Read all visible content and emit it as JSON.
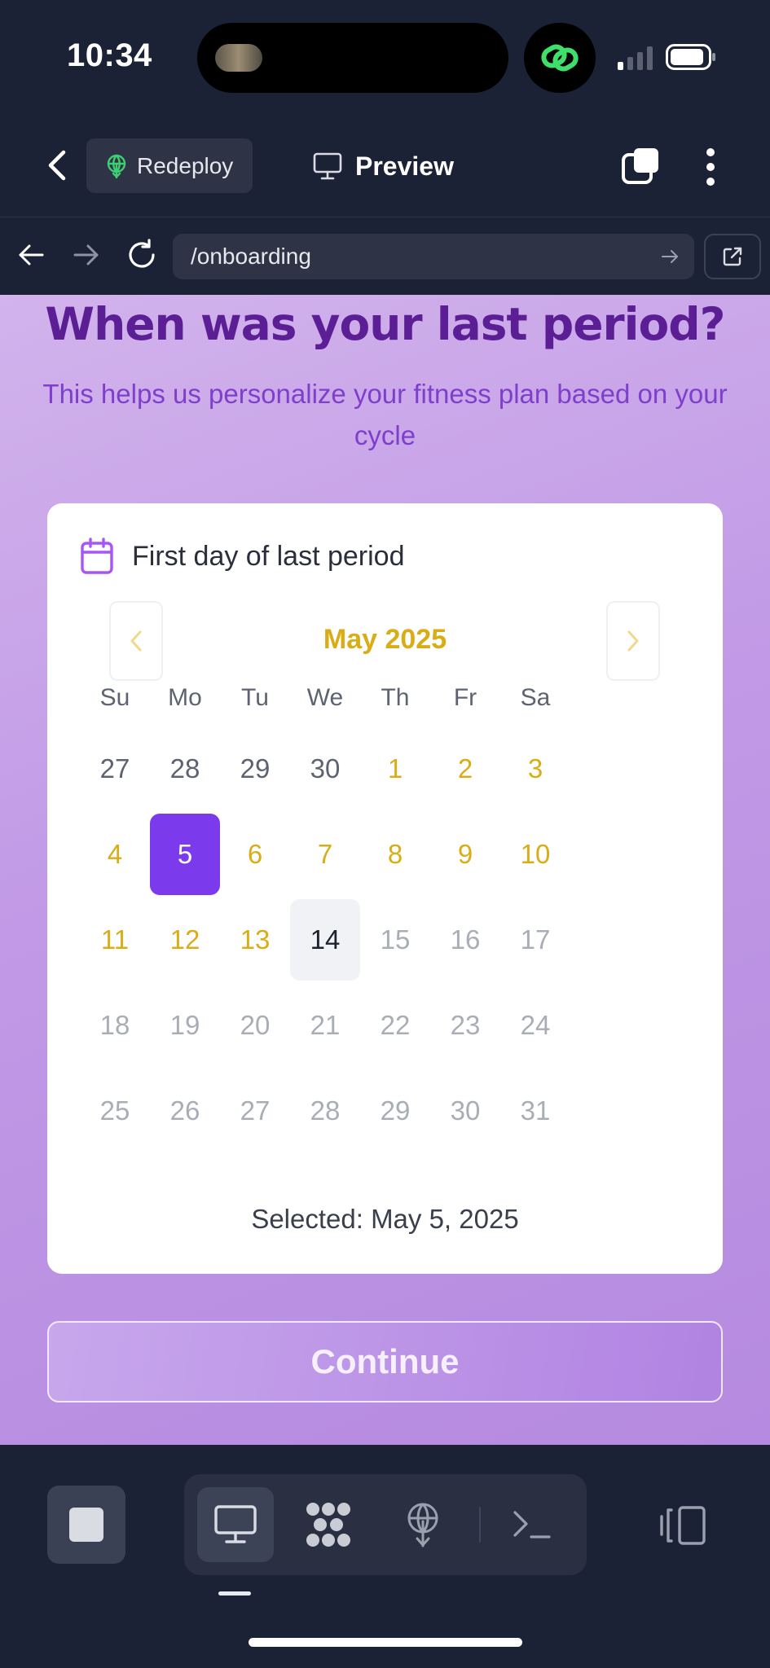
{
  "status_bar": {
    "time": "10:34",
    "icons": [
      "island-thumbnail",
      "link-icon",
      "signal-icon",
      "battery-icon"
    ],
    "accent_link_color": "#3fe06a"
  },
  "app_header": {
    "back_icon": "chevron-left-icon",
    "redeploy_label": "Redeploy",
    "redeploy_icon": "deploy-icon",
    "preview_label": "Preview",
    "preview_icon": "monitor-icon",
    "right_icons": [
      "tabs-icon",
      "more-vertical-icon"
    ]
  },
  "url_bar": {
    "url": "/onboarding",
    "icons": [
      "arrow-left-icon",
      "arrow-right-icon",
      "reload-icon",
      "go-arrow-icon",
      "external-link-icon"
    ]
  },
  "page": {
    "title": "When was your last period?",
    "subtitle": "This helps us personalize your fitness plan based on your cycle",
    "card_label": "First day of last period",
    "month_label": "May 2025",
    "weekdays": [
      "Su",
      "Mo",
      "Tu",
      "We",
      "Th",
      "Fr",
      "Sa"
    ],
    "weeks": [
      [
        {
          "d": "27",
          "s": "prev"
        },
        {
          "d": "28",
          "s": "prev"
        },
        {
          "d": "29",
          "s": "prev"
        },
        {
          "d": "30",
          "s": "prev"
        },
        {
          "d": "1",
          "s": "avail"
        },
        {
          "d": "2",
          "s": "avail"
        },
        {
          "d": "3",
          "s": "avail"
        }
      ],
      [
        {
          "d": "4",
          "s": "avail"
        },
        {
          "d": "5",
          "s": "selected"
        },
        {
          "d": "6",
          "s": "avail"
        },
        {
          "d": "7",
          "s": "avail"
        },
        {
          "d": "8",
          "s": "avail"
        },
        {
          "d": "9",
          "s": "avail"
        },
        {
          "d": "10",
          "s": "avail"
        }
      ],
      [
        {
          "d": "11",
          "s": "avail"
        },
        {
          "d": "12",
          "s": "avail"
        },
        {
          "d": "13",
          "s": "avail"
        },
        {
          "d": "14",
          "s": "today"
        },
        {
          "d": "15",
          "s": "future"
        },
        {
          "d": "16",
          "s": "future"
        },
        {
          "d": "17",
          "s": "future"
        }
      ],
      [
        {
          "d": "18",
          "s": "future"
        },
        {
          "d": "19",
          "s": "future"
        },
        {
          "d": "20",
          "s": "future"
        },
        {
          "d": "21",
          "s": "future"
        },
        {
          "d": "22",
          "s": "future"
        },
        {
          "d": "23",
          "s": "future"
        },
        {
          "d": "24",
          "s": "future"
        }
      ],
      [
        {
          "d": "25",
          "s": "future"
        },
        {
          "d": "26",
          "s": "future"
        },
        {
          "d": "27",
          "s": "future"
        },
        {
          "d": "28",
          "s": "future"
        },
        {
          "d": "29",
          "s": "future"
        },
        {
          "d": "30",
          "s": "future"
        },
        {
          "d": "31",
          "s": "future"
        }
      ]
    ],
    "selected_text": "Selected: May 5, 2025",
    "continue_label": "Continue",
    "colors": {
      "title": "#5b1e95",
      "subtitle": "#7e3fcb",
      "month_accent": "#d8ad16",
      "selected_day": "#7c3aed"
    }
  },
  "bottom_toolbar": {
    "icons": [
      "stop-icon",
      "monitor-icon",
      "apps-icon",
      "deploy-icon",
      "terminal-icon",
      "split-view-icon"
    ],
    "active": "monitor-icon"
  }
}
